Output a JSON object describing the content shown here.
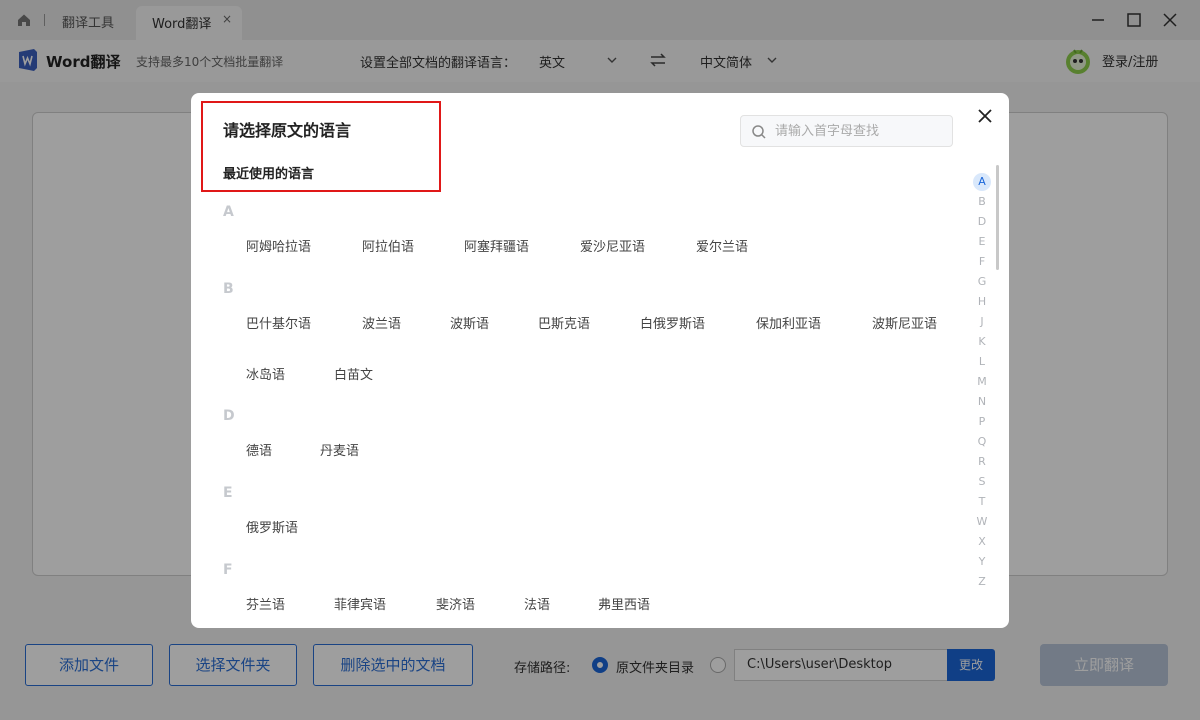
{
  "titlebar": {
    "tab_tool": "翻译工具",
    "tab_active": "Word翻译",
    "tab_close": "×"
  },
  "toolbar": {
    "app_name": "Word翻译",
    "app_sub": "支持最多10个文档批量翻译",
    "lang_label": "设置全部文档的翻译语言：",
    "source_lang": "英文",
    "target_lang": "中文简体",
    "login": "登录/注册"
  },
  "footer": {
    "add_file": "添加文件",
    "choose_folder": "选择文件夹",
    "delete_selected": "删除选中的文档",
    "save_label": "存储路径:",
    "radio_original": "原文件夹目录",
    "path_value": "C:\\Users\\user\\Desktop",
    "change": "更改",
    "translate": "立即翻译"
  },
  "modal": {
    "title": "请选择原文的语言",
    "recent": "最近使用的语言",
    "search_placeholder": "请输入首字母查找",
    "groups": [
      {
        "letter": "A",
        "langs": [
          "阿姆哈拉语",
          "阿拉伯语",
          "阿塞拜疆语",
          "爱沙尼亚语",
          "爱尔兰语"
        ]
      },
      {
        "letter": "B",
        "langs": [
          "巴什基尔语",
          "波兰语",
          "波斯语",
          "巴斯克语",
          "白俄罗斯语",
          "保加利亚语",
          "波斯尼亚语",
          "冰岛语",
          "白苗文"
        ]
      },
      {
        "letter": "D",
        "langs": [
          "德语",
          "丹麦语"
        ]
      },
      {
        "letter": "E",
        "langs": [
          "俄罗斯语"
        ]
      },
      {
        "letter": "F",
        "langs": [
          "芬兰语",
          "菲律宾语",
          "斐济语",
          "法语",
          "弗里西语"
        ]
      }
    ],
    "alpha_index": [
      "A",
      "B",
      "D",
      "E",
      "F",
      "G",
      "H",
      "J",
      "K",
      "L",
      "M",
      "N",
      "P",
      "Q",
      "R",
      "S",
      "T",
      "W",
      "X",
      "Y",
      "Z"
    ],
    "alpha_active": "A"
  },
  "colors": {
    "accent": "#1a66d9",
    "highlight": "#e01818"
  }
}
